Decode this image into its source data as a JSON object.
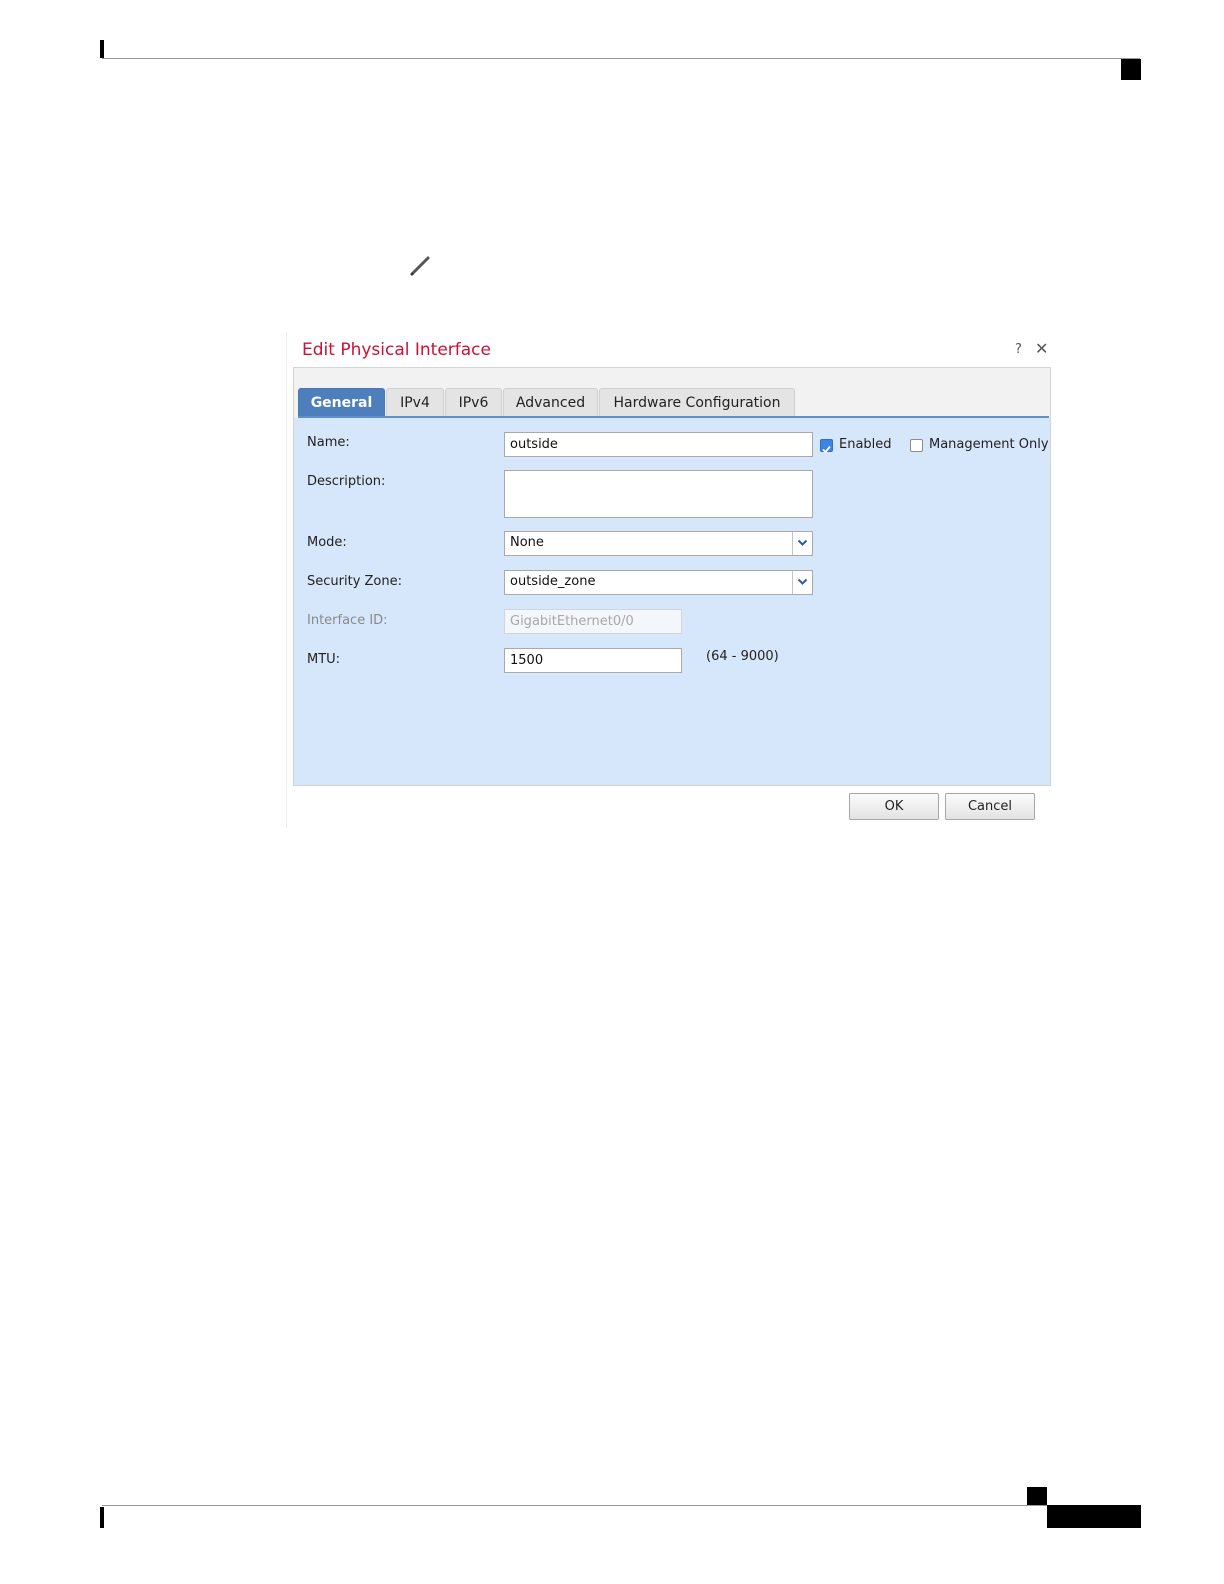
{
  "dialog": {
    "title": "Edit Physical Interface",
    "help_label": "?",
    "close_label": "✕"
  },
  "tabs": [
    {
      "label": "General",
      "active": true
    },
    {
      "label": "IPv4",
      "active": false
    },
    {
      "label": "IPv6",
      "active": false
    },
    {
      "label": "Advanced",
      "active": false
    },
    {
      "label": "Hardware Configuration",
      "active": false
    }
  ],
  "form": {
    "name": {
      "label": "Name:",
      "value": "outside"
    },
    "enabled": {
      "label": "Enabled",
      "checked": true
    },
    "management_only": {
      "label": "Management Only",
      "checked": false
    },
    "description": {
      "label": "Description:",
      "value": ""
    },
    "mode": {
      "label": "Mode:",
      "value": "None"
    },
    "security_zone": {
      "label": "Security Zone:",
      "value": "outside_zone"
    },
    "interface_id": {
      "label": "Interface ID:",
      "value": "GigabitEthernet0/0"
    },
    "mtu": {
      "label": "MTU:",
      "value": "1500",
      "range_hint": "(64 - 9000)"
    }
  },
  "buttons": {
    "ok": "OK",
    "cancel": "Cancel"
  },
  "colors": {
    "title": "#cc1133",
    "active_tab": "#4e7fbd",
    "form_background": "#d6e6fb",
    "checkbox_on": "#3d84e4"
  },
  "icons": {
    "edit": "pencil-icon",
    "dropdown": "chevron-down-icon"
  }
}
